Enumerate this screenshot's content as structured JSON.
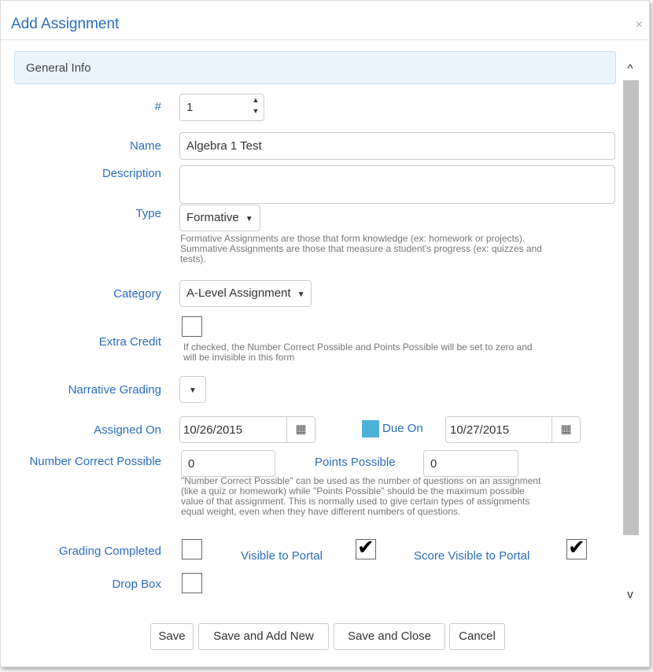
{
  "dialog": {
    "title": "Add Assignment",
    "close": "×"
  },
  "section": {
    "title": "General Info"
  },
  "scrollbar": {
    "up": "^",
    "down": "v"
  },
  "form": {
    "number": {
      "label": "#",
      "value": "1",
      "up": "▲",
      "down": "▼"
    },
    "name": {
      "label": "Name",
      "value": "Algebra 1 Test"
    },
    "description": {
      "label": "Description",
      "value": ""
    },
    "type": {
      "label": "Type",
      "value": "Formative",
      "caret": "▼",
      "hint_line1": "Formative Assignments are those that form knowledge (ex: homework or projects).",
      "hint_line2": "Summative Assignments are those that measure a student's progress (ex: quizzes and",
      "hint_line3": "tests)."
    },
    "category": {
      "label": "Category",
      "value": "A-Level Assignment",
      "caret": "▼"
    },
    "extra_credit": {
      "label": "Extra Credit",
      "checked": false,
      "hint_line1": "If checked, the Number Correct Possible and Points Possible will be set to zero and",
      "hint_line2": "will be invisible in this form"
    },
    "narrative_grading": {
      "label": "Narrative Grading",
      "value": "",
      "caret": "▼"
    },
    "assigned_on": {
      "label": "Assigned On",
      "value": "10/26/2015",
      "icon": "▦"
    },
    "due_on": {
      "label": "Due On",
      "value": "10/27/2015",
      "icon": "▦",
      "swatch_color": "#4db2d8"
    },
    "number_correct_possible": {
      "label": "Number Correct Possible",
      "value": "0"
    },
    "points_possible": {
      "label": "Points Possible",
      "value": "0",
      "hint_line1": "\"Number Correct Possible\" can be used as the number of questions on an assignment",
      "hint_line2": "(like a quiz or homework) while \"Points Possible\" should be the maximum possible",
      "hint_line3": "value of that assignment. This is normally used to give certain types of assignments",
      "hint_line4": "equal weight, even when they have different numbers of questions."
    },
    "grading_completed": {
      "label": "Grading Completed",
      "checked": false
    },
    "visible_to_portal": {
      "label": "Visible to Portal",
      "checked": true,
      "mark": "✔"
    },
    "score_visible_to_portal": {
      "label": "Score Visible to Portal",
      "checked": true,
      "mark": "✔"
    },
    "drop_box": {
      "label": "Drop Box",
      "checked": false
    }
  },
  "buttons": {
    "save": "Save",
    "save_and_add_new": "Save and Add New",
    "save_and_close": "Save and Close",
    "cancel": "Cancel"
  },
  "colors": {
    "label_blue": "#2a6ebb",
    "header_bg": "#eaf4fa",
    "scroll_thumb": "#c1c1c1"
  }
}
